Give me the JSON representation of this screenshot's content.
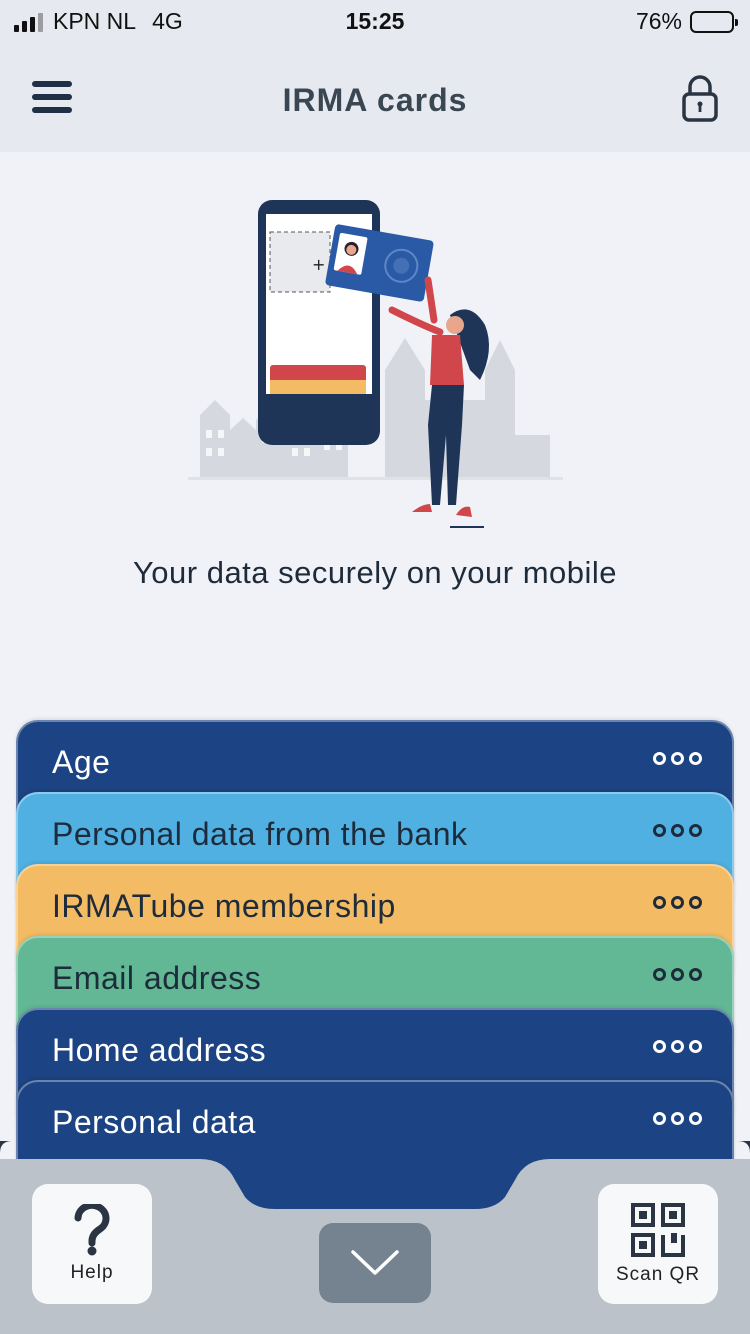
{
  "status_bar": {
    "carrier": "KPN NL",
    "network": "4G",
    "time": "15:25",
    "battery_percent": "76%",
    "battery_level": 0.76
  },
  "header": {
    "title": "IRMA cards",
    "menu_icon": "hamburger-menu-icon",
    "lock_icon": "lock-icon"
  },
  "intro": {
    "tagline": "Your data securely on your mobile"
  },
  "cards": [
    {
      "title": "Age",
      "color": "#1c4383",
      "text_color": "#ffffff"
    },
    {
      "title": "Personal data from the bank",
      "color": "#50b0e2",
      "text_color": "#1e2b3a"
    },
    {
      "title": "IRMATube membership",
      "color": "#f3bb63",
      "text_color": "#1e2b3a"
    },
    {
      "title": "Email address",
      "color": "#62b894",
      "text_color": "#1e2b3a"
    },
    {
      "title": "Home address",
      "color": "#1c4383",
      "text_color": "#ffffff"
    },
    {
      "title": "Personal data",
      "color": "#1c4383",
      "text_color": "#ffffff"
    }
  ],
  "bottom_bar": {
    "help_label": "Help",
    "scan_label": "Scan QR",
    "help_icon": "question-mark-icon",
    "scan_icon": "qr-code-icon",
    "collapse_icon": "chevron-down-icon",
    "background": "#bcc2ca"
  }
}
